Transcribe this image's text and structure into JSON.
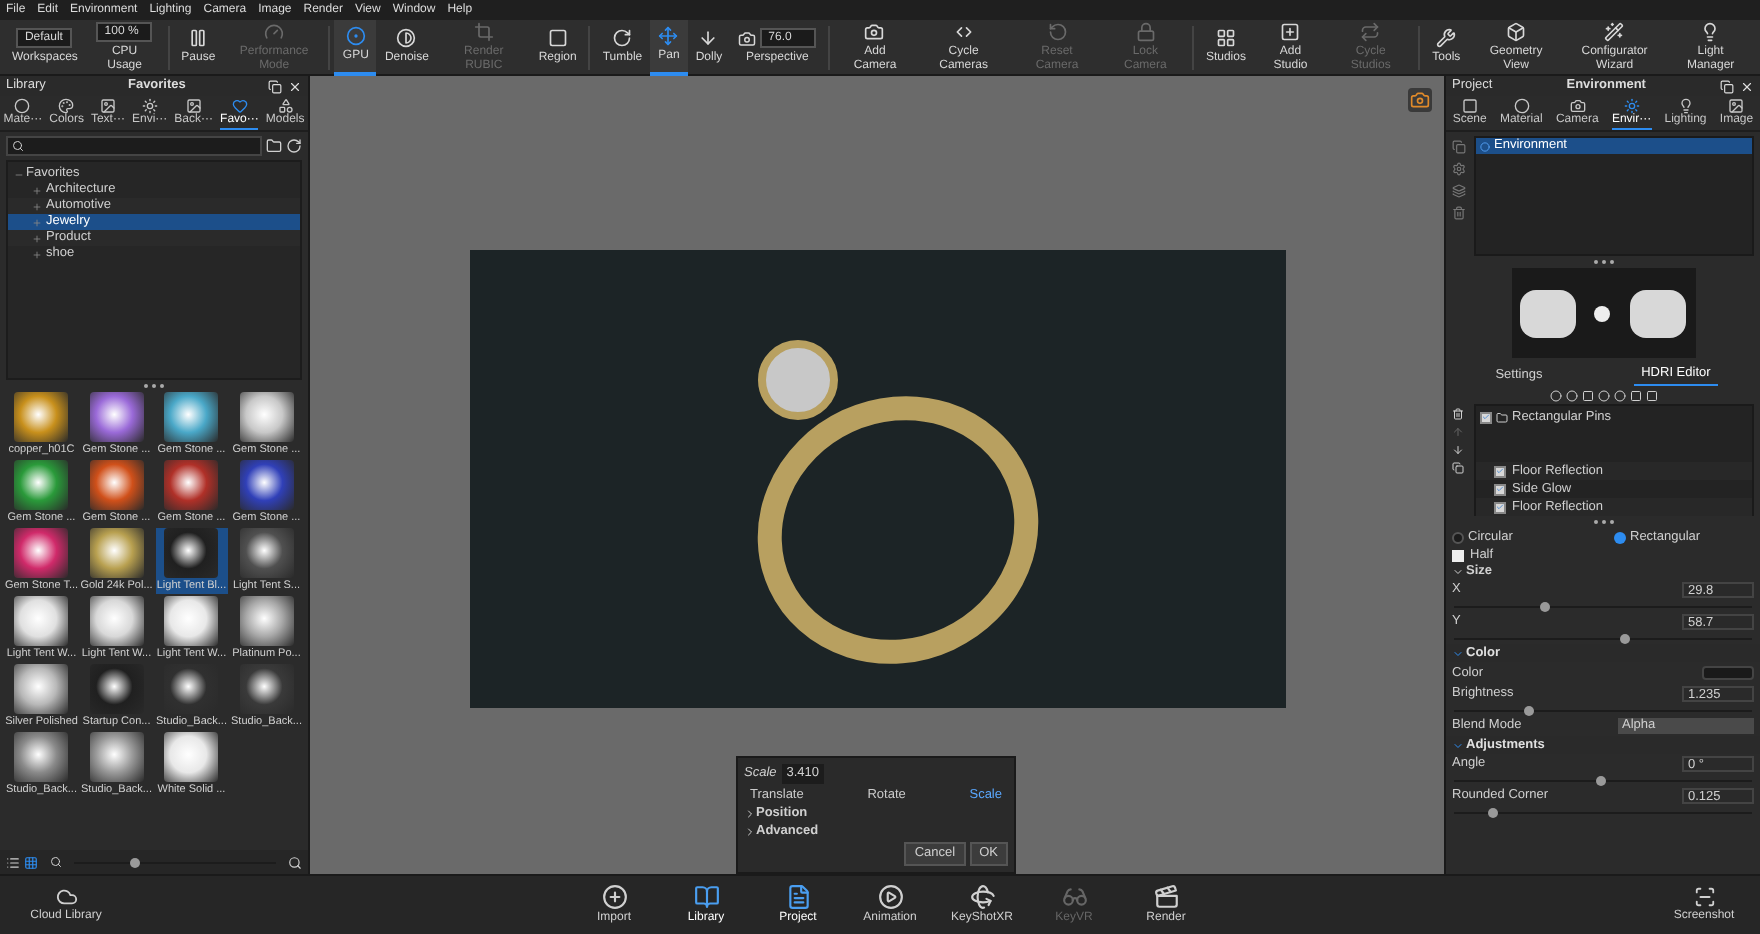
{
  "menu": [
    "File",
    "Edit",
    "Environment",
    "Lighting",
    "Camera",
    "Image",
    "Render",
    "View",
    "Window",
    "Help"
  ],
  "toolbar": [
    {
      "kind": "field",
      "label": "Workspaces",
      "value": "Default",
      "selected": false,
      "disabled": false
    },
    {
      "kind": "field",
      "label": "CPU Usage",
      "value": "100 %",
      "selected": false,
      "disabled": false
    },
    {
      "kind": "icon",
      "label": "Pause",
      "selected": false,
      "disabled": false
    },
    {
      "kind": "icon",
      "label": "Performance Mode",
      "selected": false,
      "disabled": true
    },
    {
      "kind": "icon",
      "label": "GPU",
      "selected": true,
      "disabled": false
    },
    {
      "kind": "icon",
      "label": "Denoise",
      "selected": false,
      "disabled": false
    },
    {
      "kind": "icon",
      "label": "Render RUBIC",
      "selected": false,
      "disabled": true
    },
    {
      "kind": "icon",
      "label": "Region",
      "selected": false,
      "disabled": false
    },
    {
      "kind": "icon",
      "label": "Tumble",
      "selected": false,
      "disabled": false
    },
    {
      "kind": "icon",
      "label": "Pan",
      "selected": true,
      "disabled": false
    },
    {
      "kind": "icon",
      "label": "Dolly",
      "selected": false,
      "disabled": false
    },
    {
      "kind": "field",
      "label": "Perspective",
      "value": "76.0",
      "selected": false,
      "disabled": false
    },
    {
      "kind": "icon",
      "label": "Add Camera",
      "selected": false,
      "disabled": false
    },
    {
      "kind": "icon",
      "label": "Cycle Cameras",
      "selected": false,
      "disabled": false
    },
    {
      "kind": "icon",
      "label": "Reset Camera",
      "selected": false,
      "disabled": true
    },
    {
      "kind": "icon",
      "label": "Lock Camera",
      "selected": false,
      "disabled": true
    },
    {
      "kind": "icon",
      "label": "Studios",
      "selected": false,
      "disabled": false
    },
    {
      "kind": "icon",
      "label": "Add Studio",
      "selected": false,
      "disabled": false
    },
    {
      "kind": "icon",
      "label": "Cycle Studios",
      "selected": false,
      "disabled": true
    },
    {
      "kind": "icon",
      "label": "Tools",
      "selected": false,
      "disabled": false
    },
    {
      "kind": "icon",
      "label": "Geometry View",
      "selected": false,
      "disabled": false
    },
    {
      "kind": "icon",
      "label": "Configurator Wizard",
      "selected": false,
      "disabled": false
    },
    {
      "kind": "icon",
      "label": "Light Manager",
      "selected": false,
      "disabled": false
    }
  ],
  "library": {
    "title": "Library",
    "subtitle": "Favorites",
    "tabs": [
      {
        "label": "Mate···",
        "selected": false
      },
      {
        "label": "Colors",
        "selected": false
      },
      {
        "label": "Text···",
        "selected": false
      },
      {
        "label": "Envi···",
        "selected": false
      },
      {
        "label": "Back···",
        "selected": false
      },
      {
        "label": "Favo···",
        "selected": true
      },
      {
        "label": "Models",
        "selected": false
      }
    ],
    "tree": [
      {
        "label": "Favorites",
        "expanded": true,
        "selected": false,
        "children": [
          {
            "label": "Architecture",
            "expanded": false,
            "selected": false
          },
          {
            "label": "Automotive",
            "expanded": false,
            "selected": false
          },
          {
            "label": "Jewelry",
            "expanded": false,
            "selected": true
          },
          {
            "label": "Product",
            "expanded": false,
            "selected": false
          },
          {
            "label": "shoe",
            "expanded": false,
            "selected": false
          }
        ]
      }
    ],
    "thumbnails": [
      {
        "label": "copper_h01C",
        "selected": false
      },
      {
        "label": "Gem Stone ...",
        "selected": false
      },
      {
        "label": "Gem Stone ...",
        "selected": false
      },
      {
        "label": "Gem Stone ...",
        "selected": false
      },
      {
        "label": "Gem Stone ...",
        "selected": false
      },
      {
        "label": "Gem Stone ...",
        "selected": false
      },
      {
        "label": "Gem Stone ...",
        "selected": false
      },
      {
        "label": "Gem Stone ...",
        "selected": false
      },
      {
        "label": "Gem Stone T...",
        "selected": false
      },
      {
        "label": "Gold 24k Pol...",
        "selected": false
      },
      {
        "label": "Light Tent Bl...",
        "selected": true
      },
      {
        "label": "Light Tent S...",
        "selected": false
      },
      {
        "label": "Light Tent W...",
        "selected": false
      },
      {
        "label": "Light Tent W...",
        "selected": false
      },
      {
        "label": "Light Tent W...",
        "selected": false
      },
      {
        "label": "Platinum Po...",
        "selected": false
      },
      {
        "label": "Silver Polished",
        "selected": false
      },
      {
        "label": "Startup Con...",
        "selected": false
      },
      {
        "label": "Studio_Back...",
        "selected": false
      },
      {
        "label": "Studio_Back...",
        "selected": false
      },
      {
        "label": "Studio_Back...",
        "selected": false
      },
      {
        "label": "Studio_Back...",
        "selected": false
      },
      {
        "label": "White Solid ...",
        "selected": false
      }
    ],
    "view_modes": [
      {
        "kind": "list",
        "selected": false
      },
      {
        "kind": "grid",
        "selected": true
      }
    ],
    "zoom": {
      "level": 0.3
    }
  },
  "viewport": {
    "transform": {
      "scale_label": "Scale",
      "scale_value": "3.410",
      "modes": [
        {
          "label": "Translate",
          "selected": false
        },
        {
          "label": "Rotate",
          "selected": false
        },
        {
          "label": "Scale",
          "selected": true
        }
      ],
      "sections": [
        {
          "label": "Position",
          "expanded": false
        },
        {
          "label": "Advanced",
          "expanded": false
        }
      ],
      "buttons": [
        "Cancel",
        "OK"
      ]
    }
  },
  "project": {
    "title": "Project",
    "subtitle": "Environment",
    "tabs": [
      {
        "label": "Scene",
        "selected": false
      },
      {
        "label": "Material",
        "selected": false
      },
      {
        "label": "Camera",
        "selected": false
      },
      {
        "label": "Envir···",
        "selected": true
      },
      {
        "label": "Lighting",
        "selected": false
      },
      {
        "label": "Image",
        "selected": false
      }
    ],
    "environments": [
      {
        "label": "Environment",
        "selected": true
      }
    ],
    "subtabs": [
      {
        "label": "Settings",
        "selected": false
      },
      {
        "label": "HDRI Editor",
        "selected": true
      }
    ],
    "lights": [
      {
        "label": "Rectangular Pins",
        "checked": true,
        "children": [
          {
            "label": "Floor Reflection",
            "checked": true
          },
          {
            "label": "Side Glow",
            "checked": true
          },
          {
            "label": "Floor Reflection",
            "checked": true
          }
        ]
      }
    ],
    "shapes": [
      {
        "label": "Circular",
        "selected": false
      },
      {
        "label": "Rectangular",
        "selected": true
      }
    ],
    "half": {
      "label": "Half",
      "checked": false
    },
    "size": {
      "label": "Size",
      "expanded": true,
      "rows": [
        {
          "label": "X",
          "value": "29.8",
          "level": 0.3
        },
        {
          "label": "Y",
          "value": "58.7",
          "level": 0.57
        }
      ]
    },
    "color": {
      "label": "Color",
      "expanded": true,
      "swatch_label": "Color",
      "brightness": {
        "label": "Brightness",
        "value": "1.235",
        "level": 0.25
      },
      "blend": {
        "label": "Blend Mode",
        "value": "Alpha"
      }
    },
    "adjustments": {
      "label": "Adjustments",
      "expanded": true,
      "rows": [
        {
          "label": "Angle",
          "value": "0 °",
          "level": 0.49
        },
        {
          "label": "Rounded Corner",
          "value": "0.125",
          "level": 0.13
        }
      ]
    }
  },
  "bottom_bar": {
    "left": "Cloud Library",
    "items": [
      {
        "label": "Import",
        "selected": false,
        "disabled": false
      },
      {
        "label": "Library",
        "selected": true,
        "disabled": false
      },
      {
        "label": "Project",
        "selected": true,
        "disabled": false
      },
      {
        "label": "Animation",
        "selected": false,
        "disabled": false
      },
      {
        "label": "KeyShotXR",
        "selected": false,
        "disabled": false
      },
      {
        "label": "KeyVR",
        "selected": false,
        "disabled": true
      },
      {
        "label": "Render",
        "selected": false,
        "disabled": false
      }
    ],
    "right": "Screenshot"
  }
}
